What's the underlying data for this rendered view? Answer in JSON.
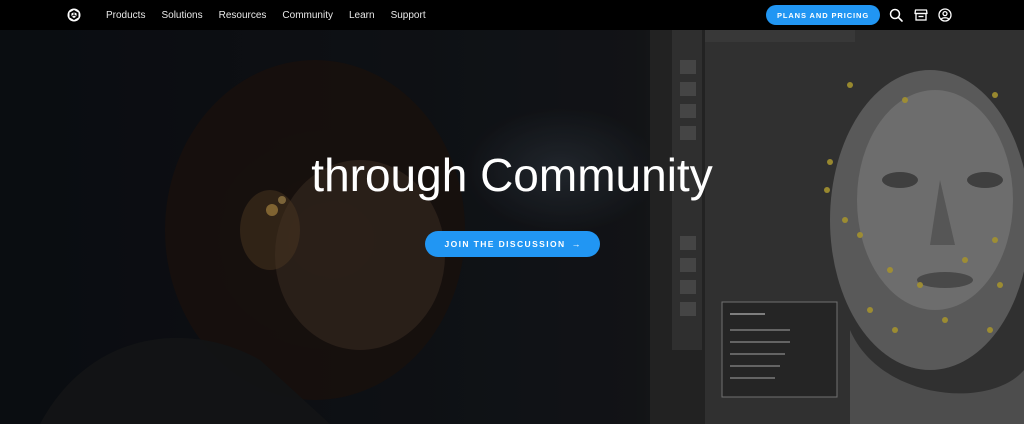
{
  "header": {
    "nav": [
      {
        "label": "Products"
      },
      {
        "label": "Solutions"
      },
      {
        "label": "Resources"
      },
      {
        "label": "Community"
      },
      {
        "label": "Learn"
      },
      {
        "label": "Support"
      }
    ],
    "plans_label": "PLANS AND PRICING"
  },
  "hero": {
    "headline": "through Community",
    "cta_label": "JOIN THE DISCUSSION",
    "cta_arrow": "→"
  },
  "colors": {
    "accent": "#2196f3",
    "topbar": "#000000",
    "text": "#ffffff"
  },
  "icons": [
    "unity-logo-icon",
    "search-icon",
    "store-icon",
    "account-icon",
    "arrow-right-icon"
  ]
}
